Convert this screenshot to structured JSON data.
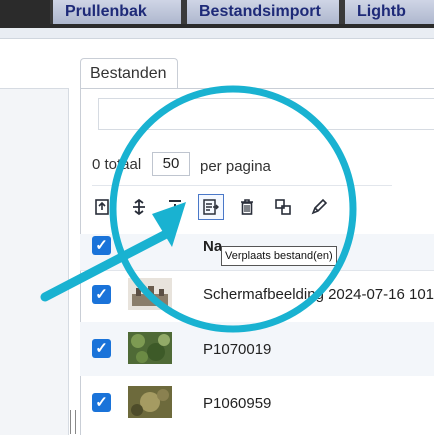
{
  "top_tabs": [
    {
      "label": "Prullenbak"
    },
    {
      "label": "Bestandsimport"
    },
    {
      "label": "Lightb"
    }
  ],
  "files_tab": {
    "label": "Bestanden"
  },
  "pagination": {
    "total_text": "0 totaal",
    "per_page_value": "50",
    "per_page_label": "per pagina"
  },
  "toolbar": {
    "icons": [
      "export-icon",
      "move-tree-icon",
      "collapse-down-icon",
      "move-files-icon",
      "trash-icon",
      "copy-icon",
      "edit-pencil-icon"
    ],
    "selected": "move-files-icon",
    "tooltip": "Verplaats bestand(en)"
  },
  "table": {
    "name_header": "Na",
    "rows": [
      {
        "name": "Schermafbeelding 2024-07-16 101",
        "checked": true
      },
      {
        "name": "P1070019",
        "checked": true
      },
      {
        "name": "P1060959",
        "checked": true
      }
    ]
  },
  "colors": {
    "highlight_circle": "#19b2d1",
    "checkbox": "#1a73d9"
  }
}
